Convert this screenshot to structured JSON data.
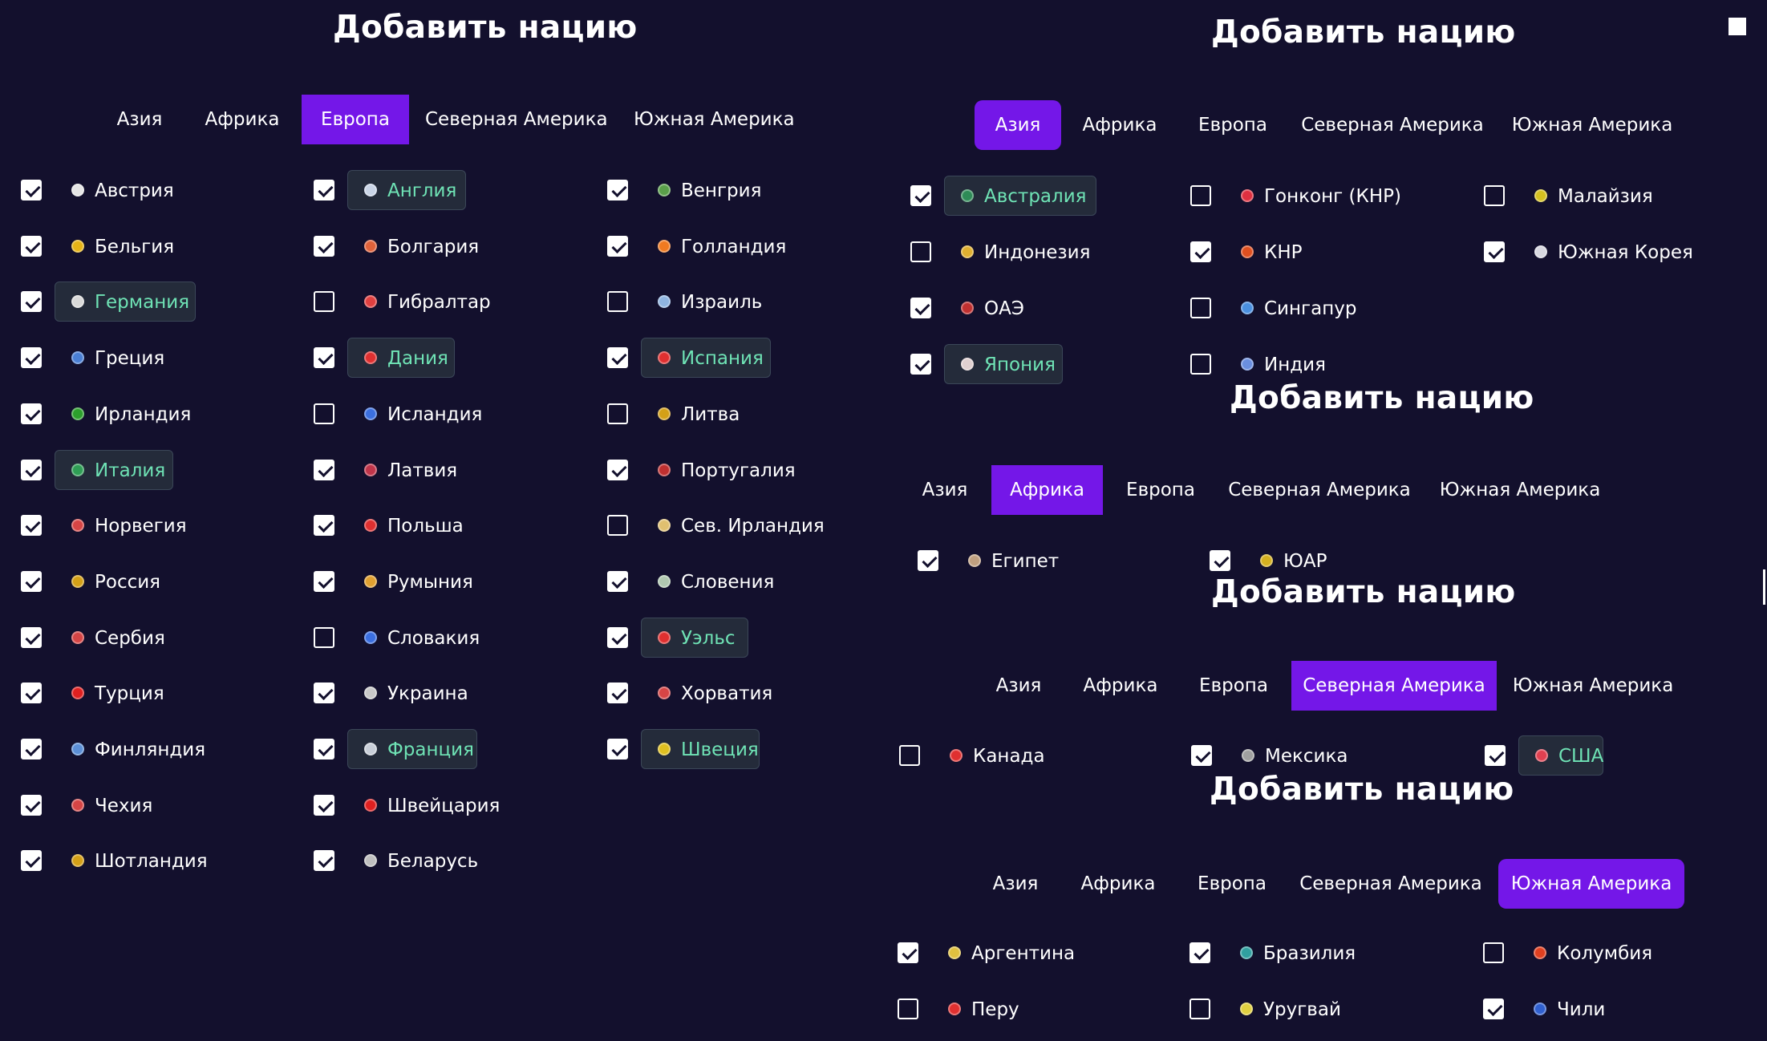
{
  "title": "Добавить нацию",
  "tab_labels": [
    "Азия",
    "Африка",
    "Европа",
    "Северная Америка",
    "Южная Америка"
  ],
  "colors": {
    "background": "#13102d",
    "accent": "#7417e8",
    "selected_text": "#6fe3b5",
    "chip_background": "#242b3a"
  },
  "panels": [
    {
      "id": "europe",
      "active_tab": 2,
      "items": [
        {
          "n": "Австрия",
          "c": true,
          "s": false,
          "f": "#e5e5e5"
        },
        {
          "n": "Бельгия",
          "c": true,
          "s": false,
          "f": "#e7b416"
        },
        {
          "n": "Германия",
          "c": true,
          "s": true,
          "f": "#d9d9d9"
        },
        {
          "n": "Греция",
          "c": true,
          "s": false,
          "f": "#4a7fd4"
        },
        {
          "n": "Ирландия",
          "c": true,
          "s": false,
          "f": "#2ca02c"
        },
        {
          "n": "Италия",
          "c": true,
          "s": true,
          "f": "#2f9e55"
        },
        {
          "n": "Норвегия",
          "c": true,
          "s": false,
          "f": "#d64545"
        },
        {
          "n": "Россия",
          "c": true,
          "s": false,
          "f": "#d4a017"
        },
        {
          "n": "Сербия",
          "c": true,
          "s": false,
          "f": "#d64545"
        },
        {
          "n": "Турция",
          "c": true,
          "s": false,
          "f": "#e02020"
        },
        {
          "n": "Финляндия",
          "c": true,
          "s": false,
          "f": "#5b8fd6"
        },
        {
          "n": "Чехия",
          "c": true,
          "s": false,
          "f": "#d64545"
        },
        {
          "n": "Шотландия",
          "c": true,
          "s": false,
          "f": "#d4a017"
        },
        {
          "n": "Англия",
          "c": true,
          "s": true,
          "f": "#c9d4e6"
        },
        {
          "n": "Болгария",
          "c": true,
          "s": false,
          "f": "#e0623a"
        },
        {
          "n": "Гибралтар",
          "c": false,
          "s": false,
          "f": "#e04040"
        },
        {
          "n": "Дания",
          "c": true,
          "s": true,
          "f": "#e03030"
        },
        {
          "n": "Исландия",
          "c": false,
          "s": false,
          "f": "#3b6fe0"
        },
        {
          "n": "Латвия",
          "c": true,
          "s": false,
          "f": "#c0354a"
        },
        {
          "n": "Польша",
          "c": true,
          "s": false,
          "f": "#e03030"
        },
        {
          "n": "Румыния",
          "c": true,
          "s": false,
          "f": "#e0a030"
        },
        {
          "n": "Словакия",
          "c": false,
          "s": false,
          "f": "#3b6fe0"
        },
        {
          "n": "Украина",
          "c": true,
          "s": false,
          "f": "#c8c8c8"
        },
        {
          "n": "Франция",
          "c": true,
          "s": true,
          "f": "#c8ced8"
        },
        {
          "n": "Швейцария",
          "c": true,
          "s": false,
          "f": "#e02020"
        },
        {
          "n": "Беларусь",
          "c": true,
          "s": false,
          "f": "#bfbfbf"
        },
        {
          "n": "Венгрия",
          "c": true,
          "s": false,
          "f": "#5aa04a"
        },
        {
          "n": "Голландия",
          "c": true,
          "s": false,
          "f": "#f07a20"
        },
        {
          "n": "Израиль",
          "c": false,
          "s": false,
          "f": "#8fb4e0"
        },
        {
          "n": "Испания",
          "c": true,
          "s": true,
          "f": "#e03030"
        },
        {
          "n": "Литва",
          "c": false,
          "s": false,
          "f": "#d4a017"
        },
        {
          "n": "Португалия",
          "c": true,
          "s": false,
          "f": "#c03030"
        },
        {
          "n": "Сев. Ирландия",
          "c": false,
          "s": false,
          "f": "#e0c070"
        },
        {
          "n": "Словения",
          "c": true,
          "s": false,
          "f": "#b0c8b0"
        },
        {
          "n": "Уэльс",
          "c": true,
          "s": true,
          "f": "#e03030"
        },
        {
          "n": "Хорватия",
          "c": true,
          "s": false,
          "f": "#d64545"
        },
        {
          "n": "Швеция",
          "c": true,
          "s": true,
          "f": "#e0c020"
        }
      ]
    },
    {
      "id": "asia",
      "active_tab": 0,
      "items": [
        {
          "n": "Австралия",
          "c": true,
          "s": true,
          "f": "#2e8b57"
        },
        {
          "n": "Индонезия",
          "c": false,
          "s": false,
          "f": "#e0b030"
        },
        {
          "n": "ОАЭ",
          "c": true,
          "s": false,
          "f": "#c03030"
        },
        {
          "n": "Япония",
          "c": true,
          "s": true,
          "f": "#e0d0d0"
        },
        {
          "n": "Гонконг (КНР)",
          "c": false,
          "s": false,
          "f": "#e03040"
        },
        {
          "n": "КНР",
          "c": true,
          "s": false,
          "f": "#e05020"
        },
        {
          "n": "Сингапур",
          "c": false,
          "s": false,
          "f": "#4a90e0"
        },
        {
          "n": "Индия",
          "c": false,
          "s": false,
          "f": "#6a8fe0"
        },
        {
          "n": "Малайзия",
          "c": false,
          "s": false,
          "f": "#d4c020"
        },
        {
          "n": "Южная Корея",
          "c": true,
          "s": false,
          "f": "#d8d8e0"
        }
      ]
    },
    {
      "id": "africa",
      "active_tab": 1,
      "items": [
        {
          "n": "Египет",
          "c": true,
          "s": false,
          "f": "#c0a080"
        },
        {
          "n": "ЮАР",
          "c": true,
          "s": false,
          "f": "#d4b020"
        }
      ]
    },
    {
      "id": "north-america",
      "active_tab": 3,
      "items": [
        {
          "n": "Канада",
          "c": false,
          "s": false,
          "f": "#e03030"
        },
        {
          "n": "Мексика",
          "c": true,
          "s": false,
          "f": "#a0a0a0"
        },
        {
          "n": "США",
          "c": true,
          "s": true,
          "f": "#e04050"
        }
      ]
    },
    {
      "id": "south-america",
      "active_tab": 4,
      "items": [
        {
          "n": "Аргентина",
          "c": true,
          "s": false,
          "f": "#e0c040"
        },
        {
          "n": "Перу",
          "c": false,
          "s": false,
          "f": "#e03030"
        },
        {
          "n": "Бразилия",
          "c": true,
          "s": false,
          "f": "#30a0a0"
        },
        {
          "n": "Уругвай",
          "c": false,
          "s": false,
          "f": "#e0d040"
        },
        {
          "n": "Колумбия",
          "c": false,
          "s": false,
          "f": "#e04020"
        },
        {
          "n": "Чили",
          "c": true,
          "s": false,
          "f": "#3060d0"
        }
      ]
    }
  ]
}
